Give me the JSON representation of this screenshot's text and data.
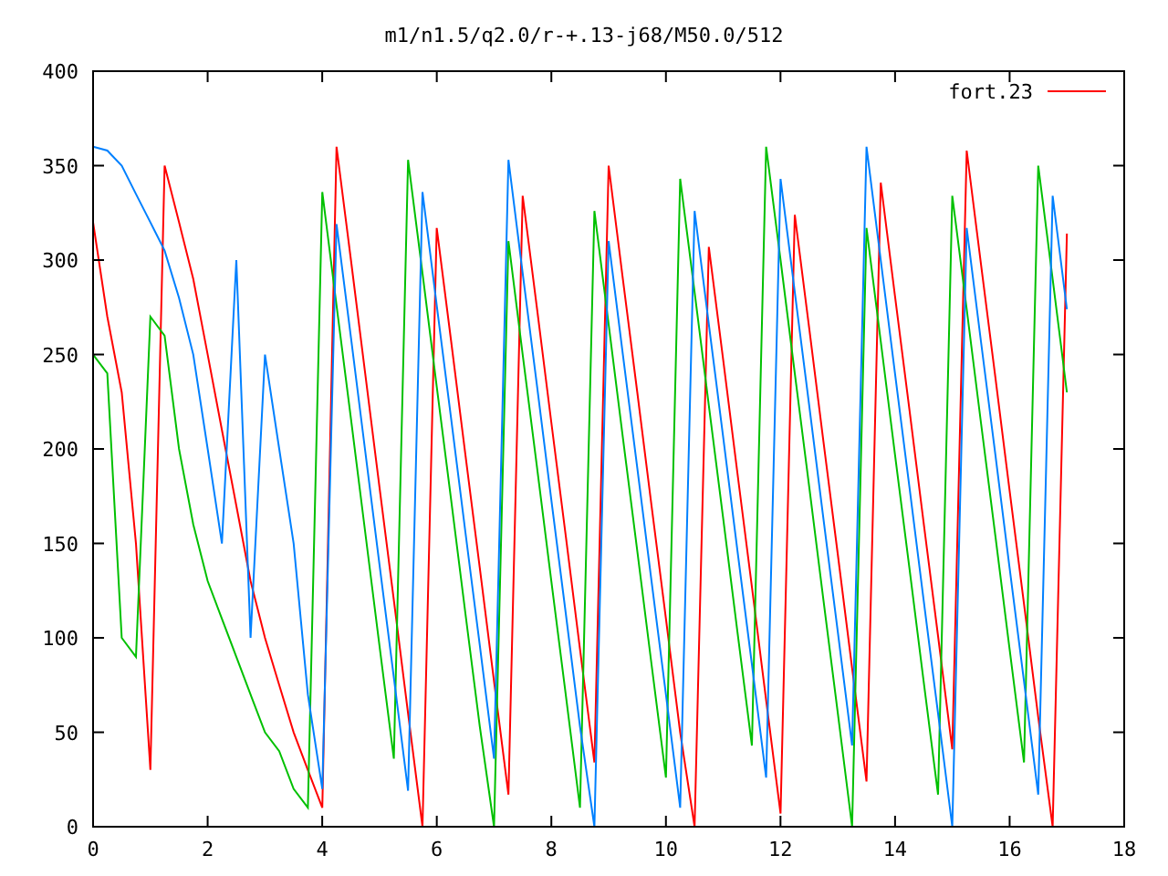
{
  "chart_data": {
    "type": "line",
    "title": "m1/n1.5/q2.0/r-+.13-j68/M50.0/512",
    "x": [
      0,
      0.25,
      0.5,
      0.75,
      1,
      1.25,
      1.5,
      1.75,
      2,
      2.25,
      2.5,
      2.75,
      3,
      3.25,
      3.5,
      3.75,
      4,
      4.25,
      4.5,
      4.75,
      5,
      5.25,
      5.5,
      5.75,
      6,
      6.25,
      6.5,
      6.75,
      7,
      7.25,
      7.5,
      7.75,
      8,
      8.25,
      8.5,
      8.75,
      9,
      9.25,
      9.5,
      9.75,
      10,
      10.25,
      10.5,
      10.75,
      11,
      11.25,
      11.5,
      11.75,
      12,
      12.25,
      12.5,
      12.75,
      13,
      13.25,
      13.5,
      13.75,
      14,
      14.25,
      14.5,
      14.75,
      15,
      15.25,
      15.5,
      15.75,
      16,
      16.25,
      16.5,
      16.75,
      17
    ],
    "series": [
      {
        "name": "fort.23",
        "color": "#ff0000",
        "values": [
          320,
          270,
          230,
          150,
          30,
          350,
          320,
          290,
          250,
          210,
          170,
          130,
          100,
          75,
          50,
          30,
          10,
          360,
          300,
          240,
          180,
          120,
          60,
          0,
          317,
          257,
          197,
          137,
          77,
          17,
          334,
          274,
          214,
          154,
          94,
          34,
          350,
          290,
          230,
          170,
          110,
          50,
          0,
          307,
          247,
          187,
          127,
          67,
          7,
          324,
          264,
          204,
          144,
          84,
          24,
          341,
          281,
          221,
          161,
          101,
          41,
          358,
          298,
          238,
          178,
          118,
          58,
          0,
          314
        ]
      },
      {
        "color": "#00c000",
        "values": [
          250,
          240,
          100,
          90,
          270,
          260,
          200,
          160,
          130,
          110,
          90,
          70,
          50,
          40,
          20,
          10,
          336,
          276,
          216,
          156,
          96,
          36,
          353,
          293,
          233,
          173,
          113,
          53,
          0,
          310,
          250,
          190,
          130,
          70,
          10,
          326,
          266,
          206,
          146,
          86,
          26,
          343,
          283,
          223,
          163,
          103,
          43,
          360,
          300,
          240,
          180,
          120,
          60,
          0,
          317,
          257,
          197,
          137,
          77,
          17,
          334,
          274,
          214,
          154,
          94,
          34,
          350,
          290,
          230
        ]
      },
      {
        "color": "#0080ff",
        "values": [
          360,
          358,
          350,
          335,
          320,
          305,
          280,
          250,
          200,
          150,
          300,
          100,
          250,
          200,
          150,
          70,
          20,
          319,
          259,
          199,
          139,
          79,
          19,
          336,
          276,
          216,
          156,
          96,
          36,
          353,
          293,
          233,
          173,
          113,
          53,
          0,
          310,
          250,
          190,
          130,
          70,
          10,
          326,
          266,
          206,
          146,
          86,
          26,
          343,
          283,
          223,
          163,
          103,
          43,
          360,
          300,
          240,
          180,
          120,
          60,
          0,
          317,
          257,
          197,
          137,
          77,
          17,
          334,
          274
        ]
      }
    ],
    "xlim": [
      0,
      18
    ],
    "ylim": [
      0,
      400
    ],
    "xticks": [
      0,
      2,
      4,
      6,
      8,
      10,
      12,
      14,
      16,
      18
    ],
    "yticks": [
      0,
      50,
      100,
      150,
      200,
      250,
      300,
      350,
      400
    ]
  }
}
